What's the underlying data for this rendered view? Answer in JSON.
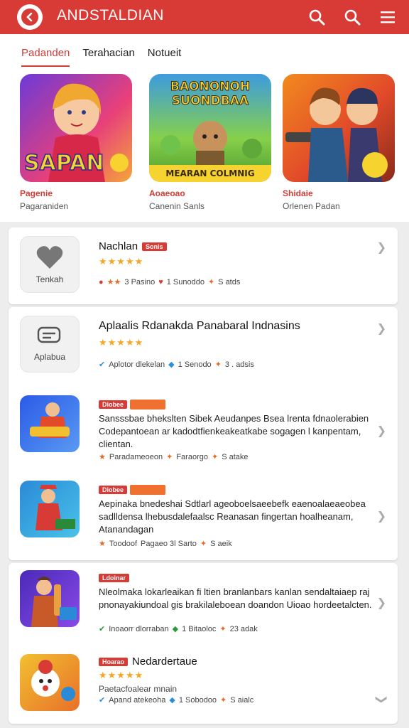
{
  "header": {
    "app_title": "ANDSTALDIAN"
  },
  "tabs": [
    {
      "label": "Padanden"
    },
    {
      "label": "Terahacian"
    },
    {
      "label": "Notueit"
    }
  ],
  "featured": [
    {
      "banner": "SAPAN",
      "title": "Pagenie",
      "sub": "Pagaraniden"
    },
    {
      "banner_top": "BAONONOH SUONDBAA",
      "banner_bottom": "MEARAN COLMNIG",
      "title": "Aoaeoao",
      "sub": "Canenin Sanls"
    },
    {
      "title": "Shidaie",
      "sub": "Orlenen Padan"
    }
  ],
  "list": [
    {
      "title": "Nachlan",
      "badge": "Sonis",
      "icon_label": "Tenkah",
      "rating": "★★★★★",
      "meta": [
        "3 Pasino",
        "1 Sunoddo",
        "S atds"
      ]
    },
    {
      "title": "Aplaalis Rdanakda Panabaral Indnasins",
      "icon_label": "Aplabua",
      "rating": "★★★★★",
      "meta": [
        "Aplotor dlekelan",
        "1 Senodo",
        "3 . adsis"
      ]
    },
    {
      "badge": "Diobee",
      "desc": "Sansssbae bhekslten Sibek Aeudanpes Bsea lrenta fdnaolerabien Codepantoean ar kadodtfienkeakeatkabe sogagen l kanpentam, clientan.",
      "meta": [
        "Paradameoeon",
        "Faraorgo",
        "S atake"
      ]
    },
    {
      "badge": "Diobee",
      "desc": "Aepinaka bnedeshai Sdtlarl ageoboelsaeebefk eaenoalaeaeobea sadlldensa lhebusdalefaalsc Reanasan fingertan hoalheanam, Atanandagan",
      "meta": [
        "Toodoof",
        "Pagaeo 3l Sarto",
        "S aeik"
      ]
    },
    {
      "badge": "Ldoinar",
      "desc": "Nleolmaka lokarleaikan fi ltien branlanbars kanlan sendaltaiaep raj pnonayakiundoal gis brakilaleboean doandon Uioao hordeetalcten.",
      "meta": [
        "Inoaorr dlorraban",
        "1 Bitaoloc",
        "23 adak"
      ]
    },
    {
      "title": "Nedardertaue",
      "badge": "Hoarao",
      "rating": "★★★★★",
      "sub": "Paetacfoalear mnain",
      "meta": [
        "Apand atekeoha",
        "1 Sobodoo",
        "S aialc"
      ]
    }
  ],
  "colors": {
    "accent": "#d83a35",
    "star": "#f5a623"
  }
}
